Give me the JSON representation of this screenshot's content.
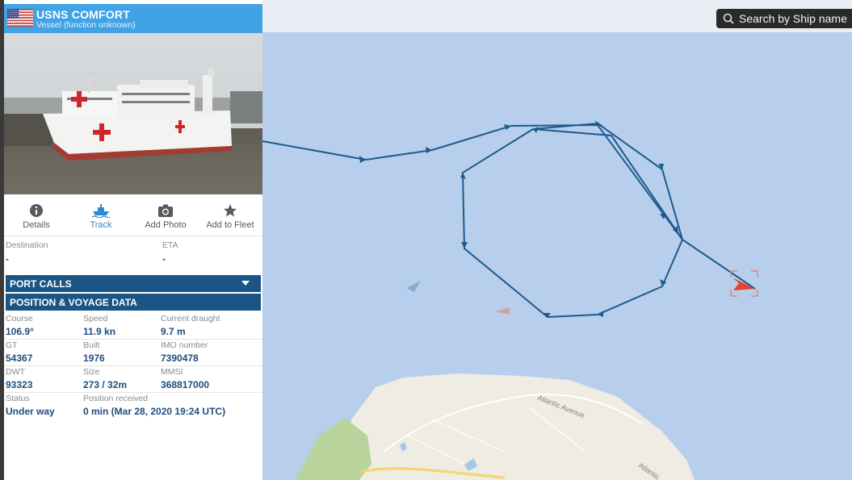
{
  "vessel": {
    "name": "USNS COMFORT",
    "type": "Vessel (function unknown)",
    "flag": "United States"
  },
  "tabs": [
    {
      "label": "Details",
      "icon": "info-icon",
      "active": false
    },
    {
      "label": "Track",
      "icon": "ship-track-icon",
      "active": true
    },
    {
      "label": "Add Photo",
      "icon": "camera-icon",
      "active": false
    },
    {
      "label": "Add to Fleet",
      "icon": "star-icon",
      "active": false
    }
  ],
  "destination": {
    "label": "Destination",
    "value": "-"
  },
  "eta": {
    "label": "ETA",
    "value": "-"
  },
  "sections": {
    "port_calls": "PORT CALLS",
    "position_voyage": "POSITION & VOYAGE DATA"
  },
  "voyage": {
    "course": {
      "label": "Course",
      "value": "106.9°"
    },
    "speed": {
      "label": "Speed",
      "value": "11.9 kn"
    },
    "draught": {
      "label": "Current draught",
      "value": "9.7 m"
    },
    "gt": {
      "label": "GT",
      "value": "54367"
    },
    "built": {
      "label": "Built",
      "value": "1976"
    },
    "imo": {
      "label": "IMO number",
      "value": "7390478"
    },
    "dwt": {
      "label": "DWT",
      "value": "93323"
    },
    "size": {
      "label": "Size",
      "value": "273 / 32m"
    },
    "mmsi": {
      "label": "MMSI",
      "value": "368817000"
    },
    "status": {
      "label": "Status",
      "value": "Under way"
    },
    "position_received": {
      "label": "Position received",
      "value": "0 min (Mar 28, 2020 19:24 UTC)"
    }
  },
  "search": {
    "placeholder": "Search by Ship name"
  },
  "map": {
    "road_labels": [
      "Atlantic Avenue",
      "Atlantic"
    ],
    "colors": {
      "water": "#b7cfec",
      "land": "#efece3",
      "park": "#b8d49c",
      "track": "#1d5a8c",
      "vessel_marker": "#e4452c",
      "header": "#3fa3e6",
      "section_bar": "#1a5585"
    }
  }
}
